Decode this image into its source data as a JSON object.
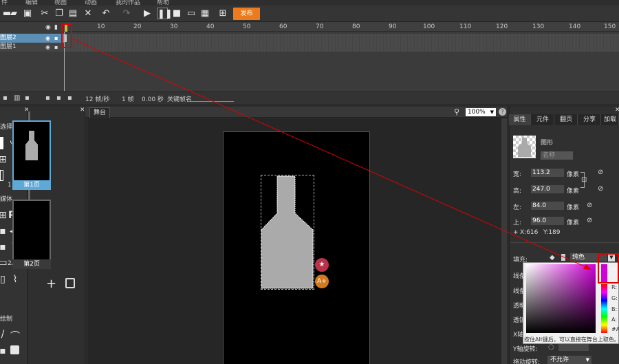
{
  "menu": [
    "件",
    "编辑",
    "视图",
    "动画",
    "我的作品",
    "帮助"
  ],
  "toolbar": {
    "publish_label": "发布"
  },
  "timeline": {
    "ruler_ticks": [
      "10",
      "20",
      "30",
      "40",
      "50",
      "60",
      "70",
      "80",
      "90",
      "100",
      "110",
      "120",
      "130",
      "140",
      "150"
    ],
    "layers": [
      "图层2",
      "图层1"
    ],
    "fps": "12 帧/秒",
    "frame": "1 帧",
    "time": "0.00 秒",
    "keyframe_label": "关键帧名"
  },
  "tools": {
    "select_label": "选择",
    "media_label": "媒体",
    "draw_label": "绘制"
  },
  "pages": [
    {
      "num": "1",
      "caption": "第1页"
    },
    {
      "num": "2",
      "caption": "第2页"
    }
  ],
  "stage": {
    "tab": "舞台",
    "zoom": "100%"
  },
  "properties": {
    "tabs": [
      "属性",
      "元件",
      "翻页",
      "分享",
      "加载"
    ],
    "type": "图形",
    "name_placeholder": "名称",
    "width_label": "宽:",
    "width": "113.2",
    "height_label": "高:",
    "height": "247.0",
    "left_label": "左:",
    "left": "84.0",
    "top_label": "上:",
    "top": "96.0",
    "unit": "像素",
    "coord_x": "X:616",
    "coord_y": "Y:189",
    "fill_label": "填充:",
    "fill_type": "纯色",
    "row_labels": [
      "线条",
      "线条",
      "透明",
      "透镜",
      "X轴",
      "Y轴旋转:"
    ],
    "drag_rotate_label": "拖动旋转:",
    "drag_rotate_value": "不允许"
  },
  "color_picker": {
    "hint": "按住Alt键后，可以直接在舞台上取色。",
    "channels": [
      "R:",
      "G:",
      "B:",
      "A:"
    ],
    "hex": "#A"
  },
  "colors": {
    "publish": "#ec7b1d",
    "selected_layer": "#5b8fb5",
    "annotation": "#e00000"
  }
}
